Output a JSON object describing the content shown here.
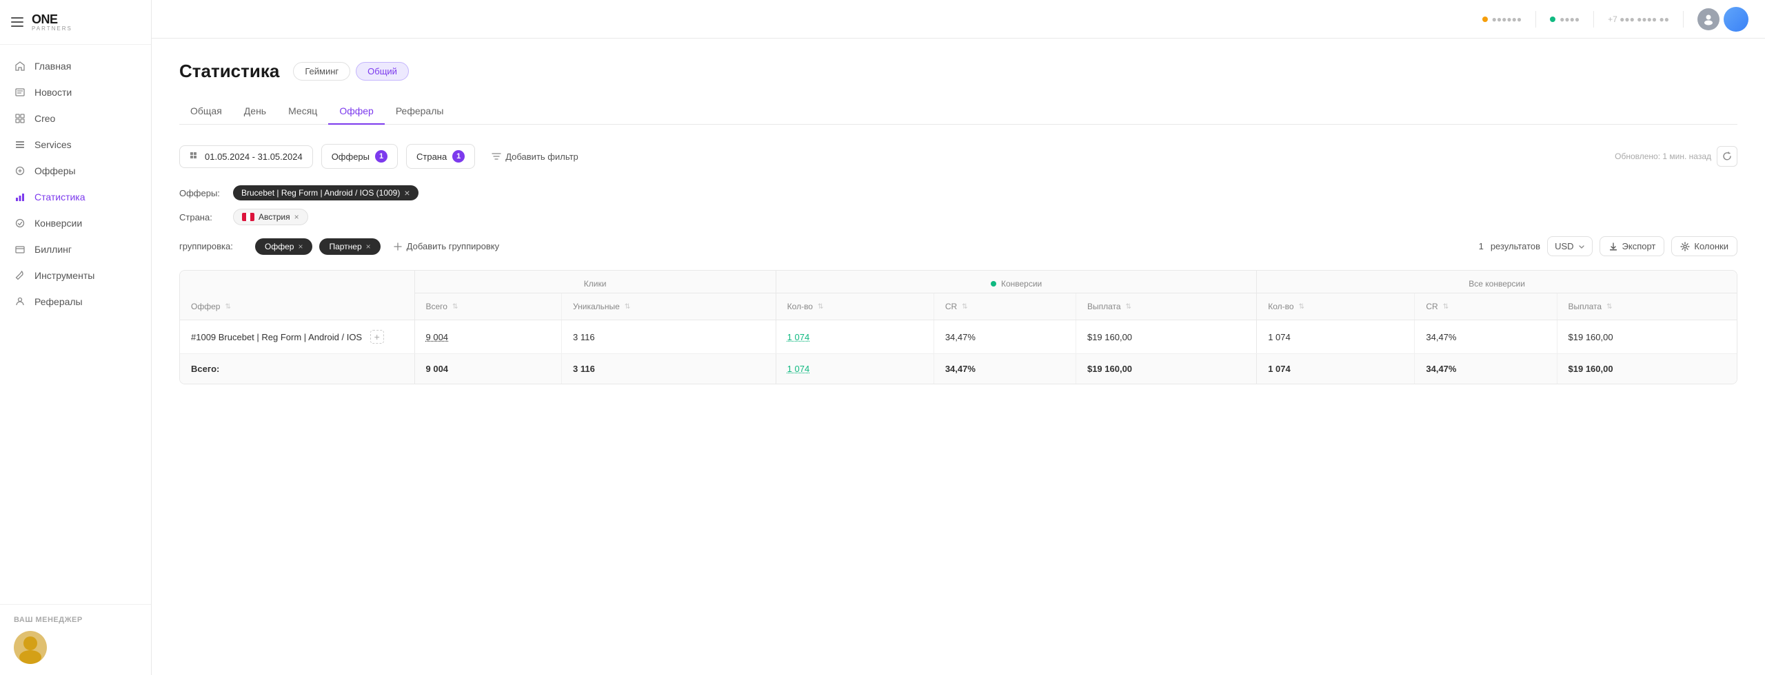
{
  "sidebar": {
    "logo": "ONE",
    "logo_sub": "PARTNERS",
    "nav": [
      {
        "id": "home",
        "label": "Главная",
        "icon": "home"
      },
      {
        "id": "news",
        "label": "Новости",
        "icon": "news"
      },
      {
        "id": "creo",
        "label": "Creo",
        "icon": "creo"
      },
      {
        "id": "services",
        "label": "Services",
        "icon": "services"
      },
      {
        "id": "offers",
        "label": "Офферы",
        "icon": "offers"
      },
      {
        "id": "stats",
        "label": "Статистика",
        "icon": "stats",
        "active": true
      },
      {
        "id": "conversions",
        "label": "Конверсии",
        "icon": "conversions"
      },
      {
        "id": "billing",
        "label": "Биллинг",
        "icon": "billing"
      },
      {
        "id": "tools",
        "label": "Инструменты",
        "icon": "tools"
      },
      {
        "id": "referrals",
        "label": "Рефералы",
        "icon": "referrals"
      }
    ],
    "manager_label": "ВАШ МЕНЕДЖЕР"
  },
  "topbar": {
    "status1_label": "●●●●●●",
    "status2_label": "●●●●",
    "phone_label": "+7 ●●● ●●●● ●●",
    "user_label": "●●● ●●●●●●●●"
  },
  "page": {
    "title": "Статистика",
    "tabs": [
      {
        "id": "gaming",
        "label": "Гейминг"
      },
      {
        "id": "general",
        "label": "Общий",
        "active": true
      }
    ],
    "sub_tabs": [
      {
        "id": "overall",
        "label": "Общая"
      },
      {
        "id": "day",
        "label": "День"
      },
      {
        "id": "month",
        "label": "Месяц"
      },
      {
        "id": "offer",
        "label": "Оффер",
        "active": true
      },
      {
        "id": "referrals",
        "label": "Рефералы"
      }
    ]
  },
  "filters": {
    "date_range": "01.05.2024 - 31.05.2024",
    "offers_label": "Офферы",
    "offers_count": "1",
    "country_label": "Страна",
    "country_count": "1",
    "add_filter": "Добавить фильтр",
    "update_label": "Обновлено: 1 мин. назад"
  },
  "active_filters": {
    "offers_label": "Офферы:",
    "offer_tag": "Brucebet | Reg Form | Android / IOS (1009)",
    "country_label": "Страна:",
    "country_name": "Австрия"
  },
  "grouping": {
    "label": "группировка:",
    "tags": [
      "Оффер",
      "Партнер"
    ],
    "add_label": "Добавить группировку",
    "results_count": "1",
    "results_label": "результатов",
    "currency": "USD",
    "export_label": "Экспорт",
    "columns_label": "Колонки"
  },
  "table": {
    "col_offer": "Оффер",
    "group_clicks": "Клики",
    "group_conversions": "Конверсии",
    "group_all_conversions": "Все конверсии",
    "col_total": "Всего",
    "col_unique": "Уникальные",
    "col_qty": "Кол-во",
    "col_cr": "CR",
    "col_payout": "Выплата",
    "col_qty2": "Кол-во",
    "col_cr2": "CR",
    "col_payout2": "Выплата",
    "rows": [
      {
        "offer": "#1009 Brucebet | Reg Form | Android / IOS",
        "total_clicks": "9 004",
        "unique_clicks": "3 116",
        "conv_qty": "1 074",
        "conv_cr": "34,47%",
        "conv_payout": "$19 160,00",
        "all_qty": "1 074",
        "all_cr": "34,47%",
        "all_payout": "$19 160,00"
      }
    ],
    "total_row": {
      "label": "Всего:",
      "total_clicks": "9 004",
      "unique_clicks": "3 116",
      "conv_qty": "1 074",
      "conv_cr": "34,47%",
      "conv_payout": "$19 160,00",
      "all_qty": "1 074",
      "all_cr": "34,47%",
      "all_payout": "$19 160,00"
    }
  }
}
